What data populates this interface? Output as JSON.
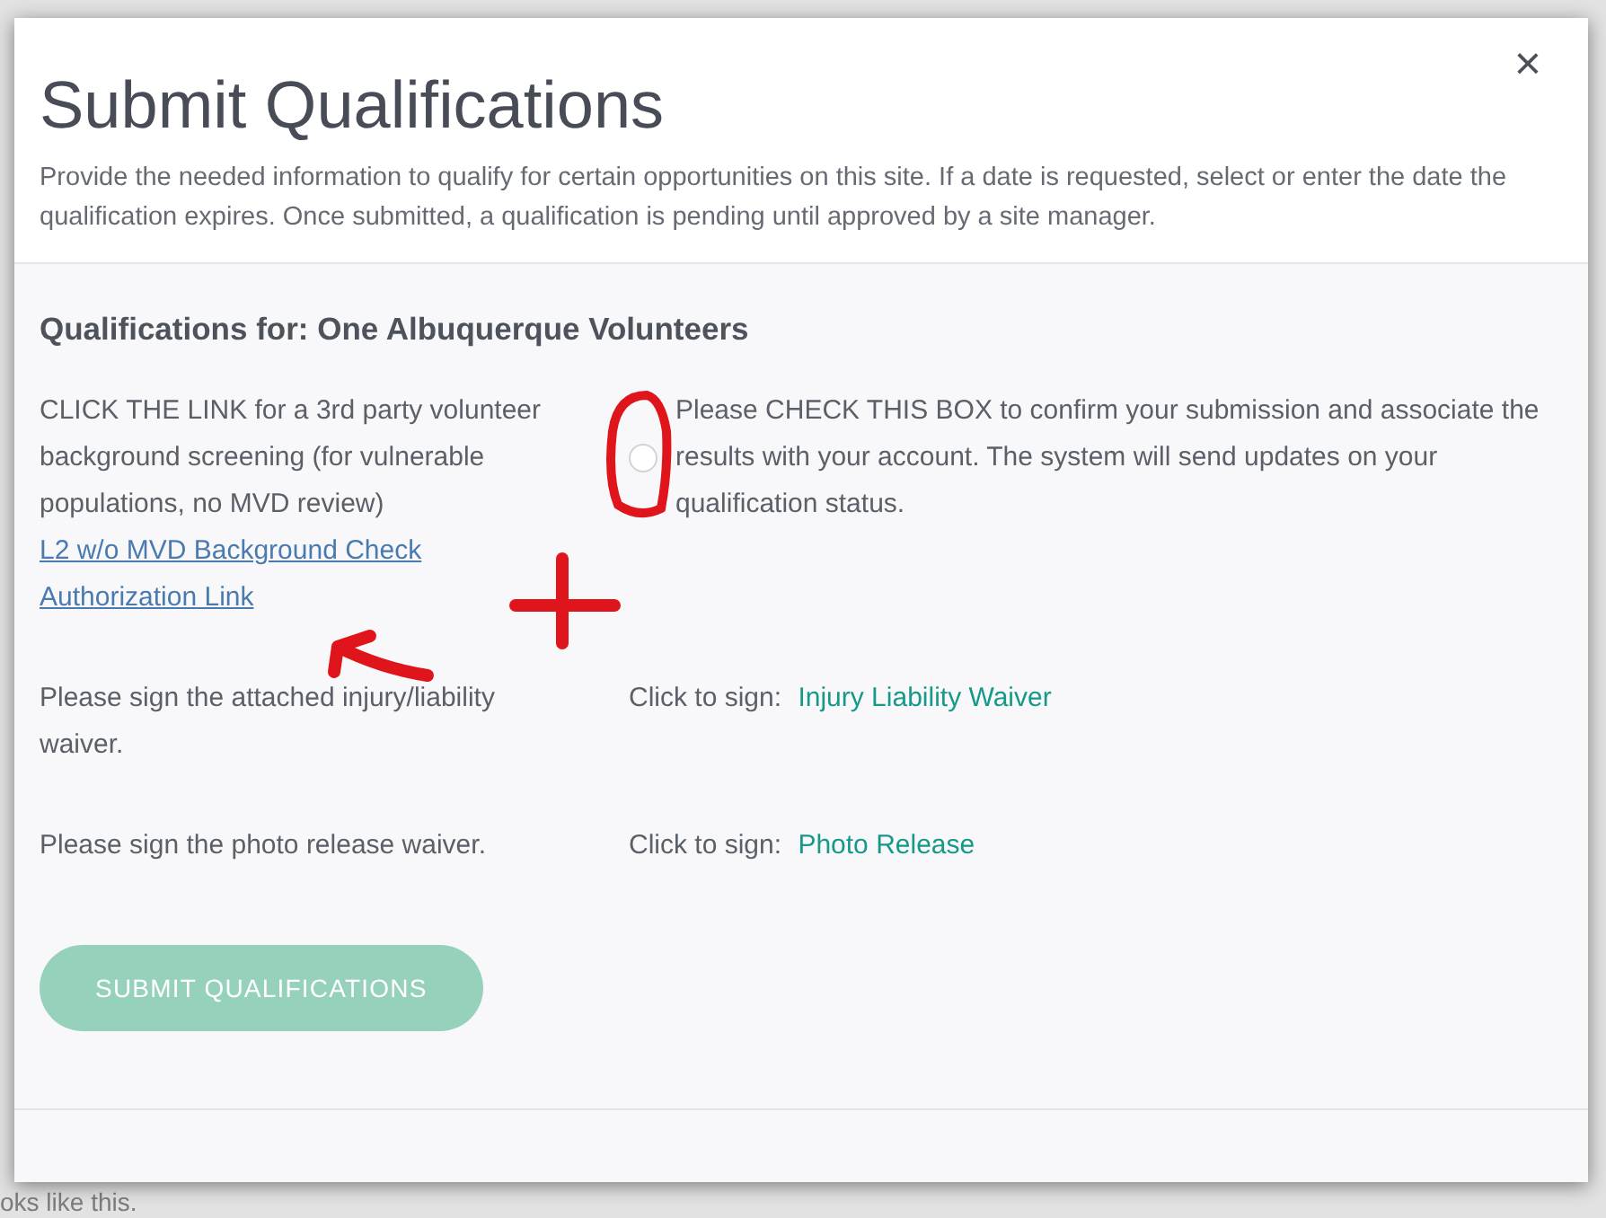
{
  "background": {
    "footer_text": "oks like this."
  },
  "modal": {
    "title": "Submit Qualifications",
    "description": "Provide the needed information to qualify for certain opportunities on this site. If a date is requested, select or enter the date the qualification expires. Once submitted, a qualification is pending until approved by a site manager.",
    "close": "×"
  },
  "section_title": "Qualifications for: One Albuquerque Volunteers",
  "qualifications": [
    {
      "kind": "link",
      "instruction": "CLICK THE LINK for a 3rd party volunteer background screening (for vulnerable populations, no MVD review)",
      "link": "L2 w/o MVD Background Check Authorization Link",
      "confirm": {
        "checked": false,
        "text": "Please CHECK THIS BOX to confirm your submission and associate the results with your account. The system will send updates on your qualification status."
      }
    },
    {
      "kind": "sign",
      "instruction": "Please sign the attached injury/liability waiver.",
      "prompt": "Click to sign:",
      "link": "Injury Liability Waiver"
    },
    {
      "kind": "sign",
      "instruction": "Please sign the photo release waiver.",
      "prompt": "Click to sign:",
      "link": "Photo Release"
    }
  ],
  "submit": {
    "label": "SUBMIT QUALIFICATIONS",
    "disabled": true
  }
}
